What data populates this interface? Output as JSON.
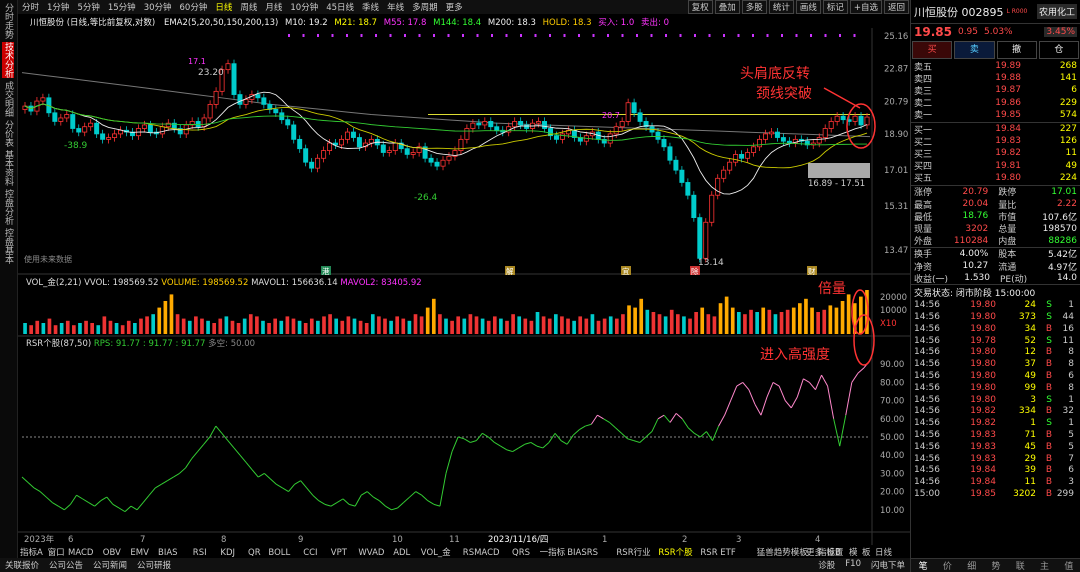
{
  "left_tabs": [
    "分时走势",
    "技术分析",
    "成交明细",
    "分价表",
    "基本资料",
    "控盘分析",
    "控盘基本"
  ],
  "periods": [
    "分时",
    "1分钟",
    "5分钟",
    "15分钟",
    "30分钟",
    "60分钟",
    "日线",
    "周线",
    "月线",
    "10分钟",
    "45日线",
    "季线",
    "年线",
    "多周期",
    "更多"
  ],
  "top_actions": [
    "复权",
    "叠加",
    "多股",
    "统计",
    "画线",
    "标记",
    "+自选",
    "返回"
  ],
  "info": {
    "name": "川恒股份 (日线,等比前复权,对数)",
    "ema": "EMA2(5,20,50,150,200,13)",
    "m10": "M10: 19.2",
    "m21": "M21: 18.7",
    "m55": "M55: 17.8",
    "m144": "M144: 18.4",
    "m200": "M200: 18.3",
    "hold": "HOLD: 18.3",
    "buy": "买入: 1.0",
    "sell": "卖出: 0"
  },
  "vol_info": {
    "name": "VOL_金(2,21)",
    "vvol": "VVOL: 198569.52",
    "volume": "VOLUME: 198569.52",
    "mavol1": "MAVOL1: 156636.14",
    "mavol2": "MAVOL2: 83405.92"
  },
  "rsr_info": {
    "name": "RSR个股(87,50)",
    "rps": "RPS: 91.77 : 91.77 : 91.77",
    "dk": "多空: 50.00"
  },
  "annotations": {
    "pattern1": "头肩底反转",
    "pattern2": "颈线突破",
    "vol": "倍量",
    "rsr": "进入高强度",
    "range": "16.89 - 17.51",
    "no_data": "使用未来数据",
    "high": "23.20",
    "high2": "17.1",
    "neck": "20.7",
    "low1": "-38.9",
    "low2": "-26.4",
    "low3": "13.14"
  },
  "markers": [
    "港",
    "解",
    "宜",
    "除",
    "财"
  ],
  "price_ticks": [
    "25.16",
    "22.87",
    "20.79",
    "18.90",
    "17.01",
    "15.31",
    "13.47"
  ],
  "vol_ticks": [
    "20000",
    "10000",
    "X10"
  ],
  "rsr_ticks": [
    "90.00",
    "80.00",
    "70.00",
    "60.00",
    "50.00",
    "40.00",
    "30.00",
    "20.00",
    "10.00"
  ],
  "x_labels": [
    "2023年",
    "6",
    "7",
    "8",
    "9",
    "10",
    "11",
    "2023/11/16/四",
    "1",
    "2",
    "3",
    "4"
  ],
  "indicators": [
    "指标A",
    "窗口",
    "MACD",
    "OBV",
    "EMV",
    "BIAS",
    "RSI",
    "KDJ",
    "QR",
    "BOLL",
    "CCI",
    "VPT",
    "WVAD",
    "ADL",
    "VOL_金",
    "RSMACD",
    "QRS",
    "一指标",
    "BIASRS",
    "RSR行业",
    "RSR个股",
    "RSR ETF",
    "猛兽趋势模板",
    "更多",
    "设置"
  ],
  "ind_right": [
    "指标B",
    "模",
    "板",
    "日线"
  ],
  "bottom_links": [
    "关联报价",
    "公司公告",
    "公司新闻",
    "公司研报"
  ],
  "bottom_right": [
    "诊股",
    "F10",
    "闪电下单"
  ],
  "stock": {
    "title": "川恒股份 002895",
    "tag": "L R000",
    "sector": "农用化工",
    "sector_pct": "3.45%",
    "price": "19.85",
    "chg": "0.95",
    "pct": "5.03%"
  },
  "buttons": [
    "买",
    "卖",
    "撤",
    "仓"
  ],
  "asks": [
    [
      "卖五",
      "19.89",
      "268"
    ],
    [
      "卖四",
      "19.88",
      "141"
    ],
    [
      "卖三",
      "19.87",
      "6"
    ],
    [
      "卖二",
      "19.86",
      "229"
    ],
    [
      "卖一",
      "19.85",
      "574"
    ]
  ],
  "bids": [
    [
      "买一",
      "19.84",
      "227"
    ],
    [
      "买二",
      "19.83",
      "126"
    ],
    [
      "买三",
      "19.82",
      "11"
    ],
    [
      "买四",
      "19.81",
      "49"
    ],
    [
      "买五",
      "19.80",
      "224"
    ]
  ],
  "stats": [
    [
      "涨停",
      "20.79",
      "跌停",
      "17.01"
    ],
    [
      "最高",
      "20.04",
      "量比",
      "2.22"
    ],
    [
      "最低",
      "18.76",
      "市值",
      "107.6亿"
    ],
    [
      "现量",
      "3202",
      "总量",
      "198570"
    ],
    [
      "外盘",
      "110284",
      "内盘",
      "88286"
    ]
  ],
  "stats2": [
    [
      "换手",
      "4.00%",
      "股本",
      "5.42亿"
    ],
    [
      "净资",
      "10.27",
      "流通",
      "4.97亿"
    ],
    [
      "收益(一)",
      "1.530",
      "PE(动)",
      "14.0"
    ]
  ],
  "status": "交易状态: 闭市阶段 15:00:00",
  "ticks": [
    [
      "14:56",
      "19.80",
      "24",
      "S",
      "1"
    ],
    [
      "14:56",
      "19.80",
      "373",
      "S",
      "44"
    ],
    [
      "14:56",
      "19.80",
      "34",
      "B",
      "16"
    ],
    [
      "14:56",
      "19.78",
      "52",
      "S",
      "11"
    ],
    [
      "14:56",
      "19.80",
      "12",
      "B",
      "8"
    ],
    [
      "14:56",
      "19.80",
      "37",
      "B",
      "8"
    ],
    [
      "14:56",
      "19.80",
      "49",
      "B",
      "6"
    ],
    [
      "14:56",
      "19.80",
      "99",
      "B",
      "8"
    ],
    [
      "14:56",
      "19.80",
      "3",
      "S",
      "1"
    ],
    [
      "14:56",
      "19.82",
      "334",
      "B",
      "32"
    ],
    [
      "14:56",
      "19.82",
      "1",
      "S",
      "1"
    ],
    [
      "14:56",
      "19.83",
      "71",
      "B",
      "5"
    ],
    [
      "14:56",
      "19.83",
      "45",
      "B",
      "5"
    ],
    [
      "14:56",
      "19.83",
      "29",
      "B",
      "7"
    ],
    [
      "14:56",
      "19.84",
      "39",
      "B",
      "6"
    ],
    [
      "14:56",
      "19.84",
      "11",
      "B",
      "3"
    ],
    [
      "15:00",
      "19.85",
      "3202",
      "B",
      "299"
    ]
  ],
  "tick_tabs": [
    "笔",
    "价",
    "细",
    "势",
    "联",
    "主",
    "值"
  ],
  "chart_data": {
    "type": "line",
    "price_scale": "log",
    "price_range": [
      13.0,
      25.6
    ],
    "candles_close": [
      20.5,
      20.2,
      20.8,
      21.0,
      20.1,
      19.6,
      19.8,
      20.0,
      19.2,
      19.0,
      19.3,
      19.5,
      18.9,
      18.6,
      18.7,
      18.9,
      19.1,
      19.0,
      18.8,
      19.2,
      19.4,
      19.0,
      18.9,
      19.3,
      19.5,
      19.2,
      18.9,
      19.4,
      19.6,
      19.3,
      19.8,
      20.6,
      21.4,
      22.8,
      23.2,
      21.2,
      20.6,
      20.9,
      21.2,
      21.0,
      20.6,
      20.3,
      20.1,
      19.7,
      19.4,
      18.6,
      18.1,
      17.4,
      17.1,
      17.6,
      18.0,
      18.4,
      18.3,
      18.6,
      19.0,
      18.7,
      18.2,
      18.4,
      18.6,
      18.3,
      17.9,
      18.0,
      18.4,
      18.1,
      17.8,
      17.9,
      18.2,
      17.6,
      17.4,
      17.2,
      17.5,
      17.7,
      18.0,
      18.6,
      19.2,
      19.5,
      19.4,
      19.6,
      19.3,
      19.1,
      19.0,
      19.3,
      19.6,
      19.4,
      19.2,
      19.5,
      19.6,
      19.2,
      18.8,
      18.6,
      18.9,
      19.1,
      18.7,
      18.5,
      18.8,
      19.0,
      18.6,
      18.4,
      18.9,
      19.3,
      19.6,
      20.7,
      20.1,
      19.6,
      19.3,
      19.0,
      18.6,
      18.2,
      17.5,
      17.0,
      16.4,
      15.8,
      14.8,
      13.14,
      14.6,
      15.8,
      16.6,
      17.0,
      17.4,
      17.8,
      17.6,
      17.9,
      18.2,
      18.6,
      18.9,
      19.0,
      18.7,
      18.5,
      18.4,
      18.6,
      18.5,
      18.3,
      18.4,
      18.7,
      19.2,
      19.6,
      19.9,
      19.7,
      19.6,
      19.9,
      19.4,
      19.85
    ],
    "ma_slow": [
      22.6,
      22.4,
      22.2,
      22.0,
      21.8,
      21.6,
      21.4,
      21.2,
      21.0,
      20.8,
      20.6,
      20.45,
      20.3,
      20.15,
      20.0,
      19.9,
      19.8,
      19.7,
      19.6,
      19.5,
      19.45,
      19.4,
      19.35,
      19.3,
      19.25,
      19.2,
      19.15,
      19.1,
      19.05,
      19.0,
      18.95,
      18.9,
      18.85,
      18.8,
      18.75
    ],
    "volume": [
      5,
      4,
      6,
      5,
      7,
      4,
      5,
      6,
      4,
      5,
      6,
      5,
      4,
      8,
      6,
      5,
      4,
      6,
      5,
      7,
      8,
      9,
      12,
      15,
      18,
      9,
      7,
      6,
      8,
      7,
      6,
      5,
      7,
      8,
      6,
      5,
      7,
      9,
      8,
      6,
      5,
      7,
      6,
      8,
      7,
      6,
      5,
      7,
      6,
      8,
      9,
      7,
      6,
      8,
      7,
      6,
      5,
      9,
      8,
      7,
      6,
      8,
      7,
      6,
      9,
      8,
      12,
      16,
      9,
      7,
      6,
      8,
      7,
      9,
      8,
      7,
      6,
      8,
      7,
      6,
      9,
      8,
      7,
      6,
      10,
      8,
      7,
      9,
      8,
      7,
      6,
      8,
      7,
      9,
      6,
      7,
      8,
      7,
      9,
      13,
      12,
      16,
      11,
      10,
      9,
      8,
      11,
      9,
      8,
      7,
      10,
      12,
      9,
      8,
      14,
      17,
      12,
      10,
      9,
      11,
      10,
      12,
      11,
      9,
      10,
      11,
      12,
      14,
      16,
      12,
      10,
      11,
      13,
      12,
      15,
      18,
      14,
      17,
      20
    ],
    "rsr": [
      28,
      25,
      22,
      20,
      17,
      14,
      12,
      10,
      13,
      18,
      16,
      14,
      12,
      15,
      17,
      13,
      11,
      9,
      12,
      10,
      14,
      18,
      22,
      24,
      26,
      28,
      30,
      33,
      38,
      42,
      46,
      50,
      56,
      52,
      48,
      44,
      40,
      36,
      32,
      28,
      30,
      27,
      24,
      22,
      20,
      24,
      26,
      22,
      18,
      15,
      13,
      12,
      14,
      16,
      13,
      12,
      18,
      20,
      17,
      15,
      12,
      10,
      11,
      14,
      17,
      20,
      18,
      15,
      13,
      12,
      30,
      42,
      50,
      49,
      47,
      48,
      52,
      50,
      47,
      45,
      43,
      42,
      44,
      46,
      47,
      45,
      44,
      47,
      52,
      48,
      46,
      51,
      54,
      56,
      57,
      62,
      60,
      58,
      55,
      52,
      49,
      48,
      47,
      50,
      53,
      60,
      62,
      58,
      63,
      60,
      55,
      52,
      50,
      53,
      48,
      56,
      62,
      70,
      78,
      80,
      76,
      68,
      62,
      72,
      80,
      78,
      70,
      66,
      72,
      82,
      80,
      76,
      84,
      78,
      60,
      45,
      62,
      80,
      85,
      88,
      92
    ]
  }
}
